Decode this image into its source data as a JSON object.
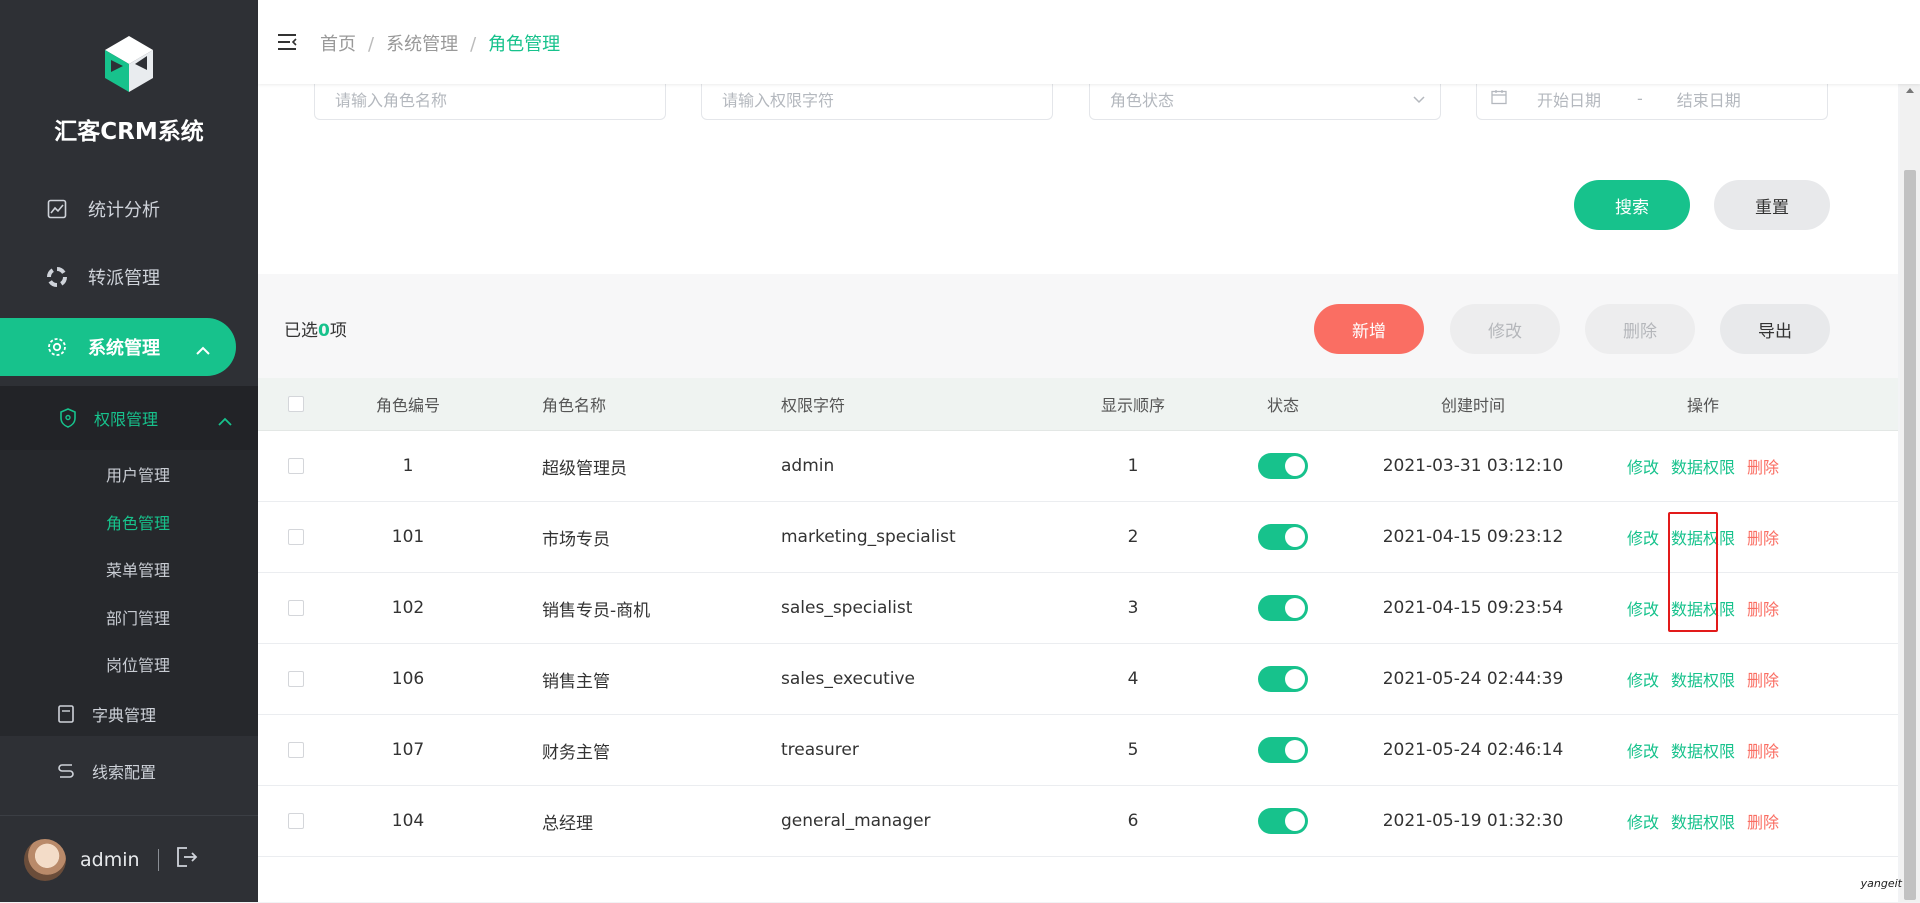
{
  "app": {
    "title": "汇客CRM系统"
  },
  "sidebar": {
    "items": [
      {
        "label": "统计分析",
        "icon": "chart-icon"
      },
      {
        "label": "转派管理",
        "icon": "transfer-icon"
      },
      {
        "label": "系统管理",
        "icon": "gear-icon"
      }
    ],
    "group": {
      "label": "权限管理",
      "icon": "shield-icon",
      "children": [
        "用户管理",
        "角色管理",
        "菜单管理",
        "部门管理",
        "岗位管理"
      ]
    },
    "extra": [
      {
        "label": "字典管理",
        "icon": "book-icon"
      },
      {
        "label": "线索配置",
        "icon": "link-icon"
      }
    ],
    "user": {
      "name": "admin"
    }
  },
  "breadcrumb": {
    "items": [
      "首页",
      "系统管理",
      "角色管理"
    ],
    "sep": "/"
  },
  "filters": {
    "role_name_placeholder": "请输入角色名称",
    "role_key_placeholder": "请输入权限字符",
    "status_placeholder": "角色状态",
    "start_date_placeholder": "开始日期",
    "date_sep": "-",
    "end_date_placeholder": "结束日期",
    "search_label": "搜索",
    "reset_label": "重置"
  },
  "toolbar": {
    "selected_prefix": "已选",
    "selected_count": "0",
    "selected_suffix": "项",
    "add_label": "新增",
    "edit_label": "修改",
    "delete_label": "删除",
    "export_label": "导出"
  },
  "table": {
    "columns": [
      "角色编号",
      "角色名称",
      "权限字符",
      "显示顺序",
      "状态",
      "创建时间",
      "操作"
    ],
    "rows": [
      {
        "id": "1",
        "name": "超级管理员",
        "key": "admin",
        "sort": "1",
        "enabled": true,
        "created": "2021-03-31 03:12:10"
      },
      {
        "id": "101",
        "name": "市场专员",
        "key": "marketing_specialist",
        "sort": "2",
        "enabled": true,
        "created": "2021-04-15 09:23:12"
      },
      {
        "id": "102",
        "name": "销售专员-商机",
        "key": "sales_specialist",
        "sort": "3",
        "enabled": true,
        "created": "2021-04-15 09:23:54"
      },
      {
        "id": "106",
        "name": "销售主管",
        "key": "sales_executive",
        "sort": "4",
        "enabled": true,
        "created": "2021-05-24 02:44:39"
      },
      {
        "id": "107",
        "name": "财务主管",
        "key": "treasurer",
        "sort": "5",
        "enabled": true,
        "created": "2021-05-24 02:46:14"
      },
      {
        "id": "104",
        "name": "总经理",
        "key": "general_manager",
        "sort": "6",
        "enabled": true,
        "created": "2021-05-19 01:32:30"
      }
    ],
    "ops": {
      "edit": "修改",
      "data_scope": "数据权限",
      "delete": "删除"
    }
  },
  "watermark": "yangeit",
  "colors": {
    "accent": "#17c28c",
    "danger": "#fa6e63",
    "sidebar": "#2e3035"
  }
}
